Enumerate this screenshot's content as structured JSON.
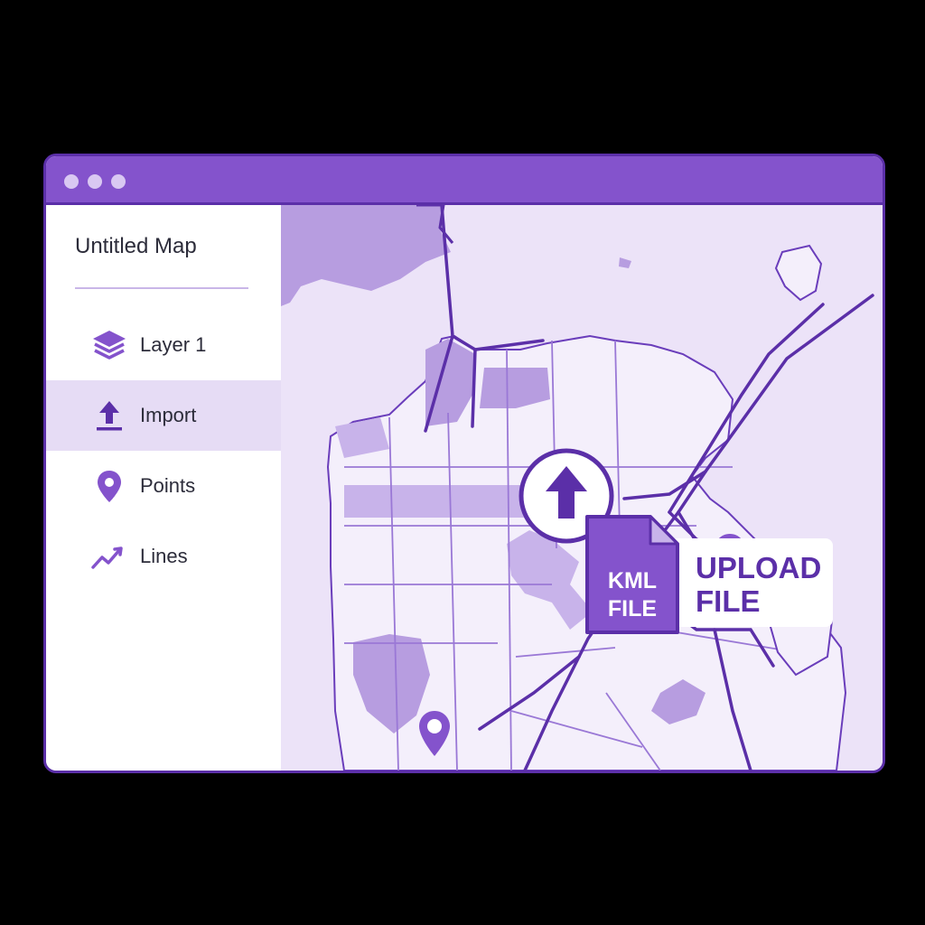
{
  "window": {
    "title_dots": [
      "window-dot-1",
      "window-dot-2",
      "window-dot-3"
    ]
  },
  "sidebar": {
    "map_title": "Untitled Map",
    "items": [
      {
        "label": "Layer 1",
        "icon": "layers-icon",
        "active": false
      },
      {
        "label": "Import",
        "icon": "upload-icon",
        "active": true
      },
      {
        "label": "Points",
        "icon": "map-pin-icon",
        "active": false
      },
      {
        "label": "Lines",
        "icon": "line-chart-icon",
        "active": false
      }
    ]
  },
  "map": {
    "upload_label": "UPLOAD\nFILE",
    "file_label": "KML\nFILE",
    "upload_icon": "upload-arrow-icon",
    "file_icon": "kml-file-icon",
    "marker_icon": "map-pin-icon"
  },
  "colors": {
    "accent": "#8453cc",
    "accent_dark": "#5b2fa8",
    "map_background": "#ece3f8",
    "land": "#f4effb",
    "park": "#b79de0",
    "active_item": "#e6dcf5"
  }
}
